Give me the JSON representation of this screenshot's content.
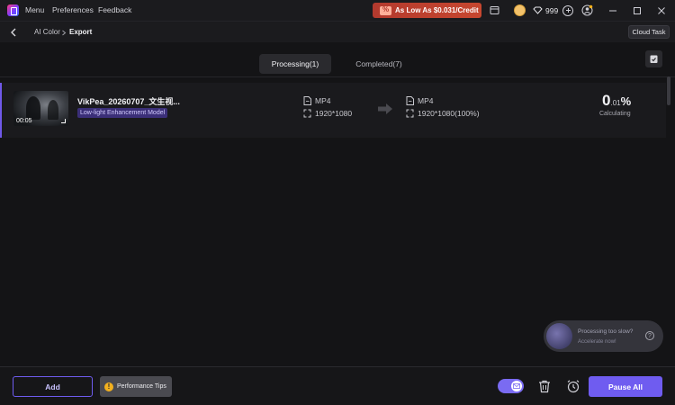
{
  "titlebar": {
    "menu": [
      "Menu",
      "Preferences",
      "Feedback"
    ],
    "promo": "As Low As $0.031/Credit",
    "credits": "999"
  },
  "breadcrumb": {
    "items": [
      "AI Color",
      "Export"
    ],
    "cloud_task": "Cloud Task"
  },
  "tabs": [
    {
      "label": "Processing(1)",
      "active": true
    },
    {
      "label": "Completed(7)",
      "active": false
    }
  ],
  "task": {
    "file_name": "VikPea_20260707_文生视...",
    "model": "Low-light Enhancement Model",
    "duration": "00:05",
    "input_format": "MP4",
    "input_resolution": "1920*1080",
    "output_format": "MP4",
    "output_resolution": "1920*1080(100%)",
    "percent_int": "0",
    "percent_dec": ".01",
    "percent_sign": "%",
    "status": "Calculating"
  },
  "toast": {
    "title": "Processing too slow?",
    "subtitle": "Accelerate now!",
    "help": "?"
  },
  "footer": {
    "add_label": "Add",
    "perf_label": "Performance Tips",
    "pause_label": "Pause All"
  },
  "colors": {
    "accent": "#6f5cf0",
    "promo": "#c7472f",
    "background": "#141416"
  }
}
